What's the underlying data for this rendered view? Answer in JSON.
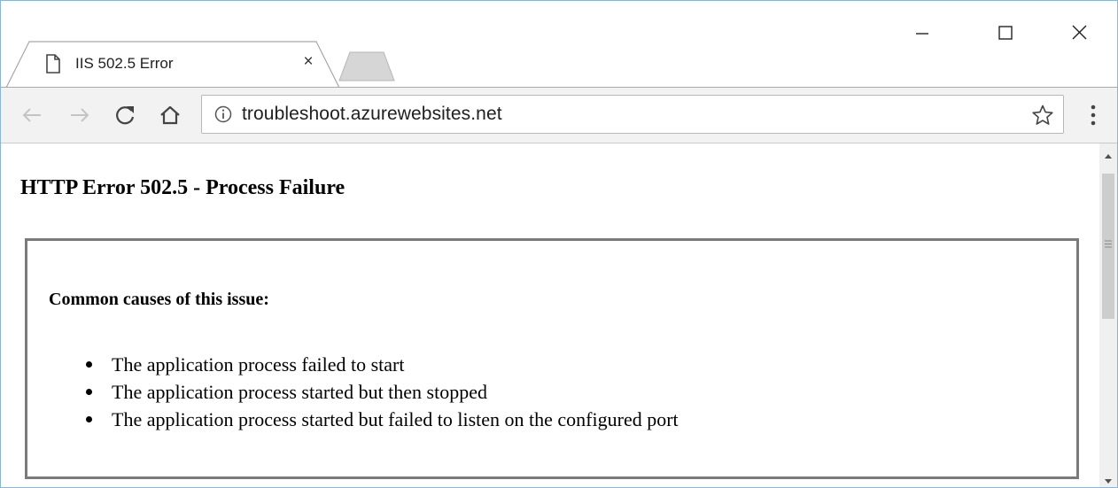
{
  "tab": {
    "title": "IIS 502.5 Error",
    "close_glyph": "×",
    "icon": "page-icon"
  },
  "window_controls": {
    "minimize_icon": "minimize-icon",
    "maximize_icon": "maximize-icon",
    "close_icon": "close-icon"
  },
  "toolbar": {
    "back_icon": "back-arrow-icon",
    "forward_icon": "forward-arrow-icon",
    "reload_icon": "reload-icon",
    "home_icon": "home-icon",
    "menu_icon": "more-vert-icon"
  },
  "address_bar": {
    "info_icon": "info-icon",
    "url": "troubleshoot.azurewebsites.net",
    "bookmark_icon": "star-icon"
  },
  "page": {
    "heading": "HTTP Error 502.5 - Process Failure",
    "causes_heading": "Common causes of this issue:",
    "causes": [
      "The application process failed to start",
      "The application process started but then stopped",
      "The application process started but failed to listen on the configured port"
    ]
  },
  "colors": {
    "toolbar_bg": "#f2f2f2",
    "window_border": "#8ab4d8",
    "box_border": "#7a7a7a",
    "scrollbar_track": "#f0f0f0",
    "scrollbar_thumb": "#cdcdcd"
  }
}
